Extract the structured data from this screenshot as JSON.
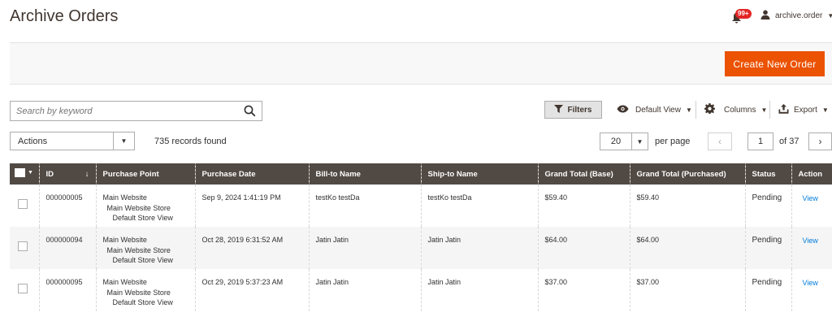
{
  "page": {
    "title": "Archive Orders"
  },
  "header": {
    "notifications_badge": "99+",
    "user_name": "archive.order"
  },
  "toolbar": {
    "create_button": "Create New Order"
  },
  "search": {
    "placeholder": "Search by keyword",
    "value": ""
  },
  "controls": {
    "filters_label": "Filters",
    "view_label": "Default View",
    "columns_label": "Columns",
    "export_label": "Export"
  },
  "mass_actions": {
    "label": "Actions"
  },
  "records_found": "735 records found",
  "pagination": {
    "per_page_value": "20",
    "per_page_label": "per page",
    "current_page": "1",
    "of_pages": "of 37"
  },
  "grid": {
    "columns": [
      "ID",
      "Purchase Point",
      "Purchase Date",
      "Bill-to Name",
      "Ship-to Name",
      "Grand Total (Base)",
      "Grand Total (Purchased)",
      "Status",
      "Action"
    ],
    "sort_arrow": "↓",
    "rows": [
      {
        "id": "000000005",
        "purchase_point": [
          "Main Website",
          "Main Website Store",
          "Default Store View"
        ],
        "date": "Sep 9, 2024 1:41:19 PM",
        "bill_to": "testKo testDa",
        "ship_to": "testKo testDa",
        "grand_base": "$59.40",
        "grand_purchased": "$59.40",
        "status": "Pending",
        "action": "View"
      },
      {
        "id": "000000094",
        "purchase_point": [
          "Main Website",
          "Main Website Store",
          "Default Store View"
        ],
        "date": "Oct 28, 2019 6:31:52 AM",
        "bill_to": "Jatin Jatin",
        "ship_to": "Jatin Jatin",
        "grand_base": "$64.00",
        "grand_purchased": "$64.00",
        "status": "Pending",
        "action": "View"
      },
      {
        "id": "000000095",
        "purchase_point": [
          "Main Website",
          "Main Website Store",
          "Default Store View"
        ],
        "date": "Oct 29, 2019 5:37:23 AM",
        "bill_to": "Jatin Jatin",
        "ship_to": "Jatin Jatin",
        "grand_base": "$37.00",
        "grand_purchased": "$37.00",
        "status": "Pending",
        "action": "View"
      }
    ]
  },
  "colors": {
    "accent": "#eb5202",
    "header_bg": "#514943",
    "link": "#007bdb",
    "badge": "#e22626"
  },
  "icons": [
    "bell-icon",
    "user-icon",
    "search-icon",
    "filter-icon",
    "eye-icon",
    "gear-icon",
    "export-icon",
    "chevron-down-icon",
    "chevron-left-icon",
    "chevron-right-icon"
  ]
}
